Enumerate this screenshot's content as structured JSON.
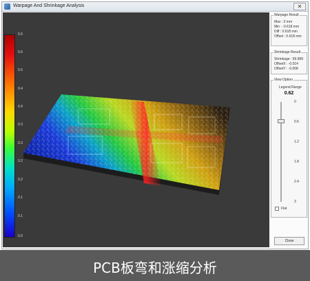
{
  "window": {
    "title": "Warpage And Shrinkage Analysis",
    "close_glyph": "✕"
  },
  "legend": {
    "ticks": [
      "0.6",
      "0.6",
      "0.5",
      "0.4",
      "0.4",
      "0.3",
      "0.3",
      "0.2",
      "0.2",
      "0.1",
      "0.1",
      "0.0"
    ]
  },
  "warpage_result": {
    "title": "Warpage Result",
    "rows": [
      "Max    : 0 mm",
      "Min    : -0.618 mm",
      "Diff   : 0.618 mm",
      "Offset : 0.618 mm"
    ]
  },
  "shrinkage_result": {
    "title": "Shrinkage Result",
    "rows": [
      "Shrinkage : 99.989",
      "OffsetX   : -0.014",
      "OffsetY   : -0.008"
    ]
  },
  "view_option": {
    "title": "View Option",
    "legend_range_label": "Legend Range",
    "legend_range_value": "0.62",
    "slider_ticks": [
      "0",
      "0.6",
      "1.2",
      "1.8",
      "2.4",
      "3"
    ],
    "flat_label": "Flat"
  },
  "close_button": "Close",
  "caption": "PCB板弯和涨缩分析"
}
